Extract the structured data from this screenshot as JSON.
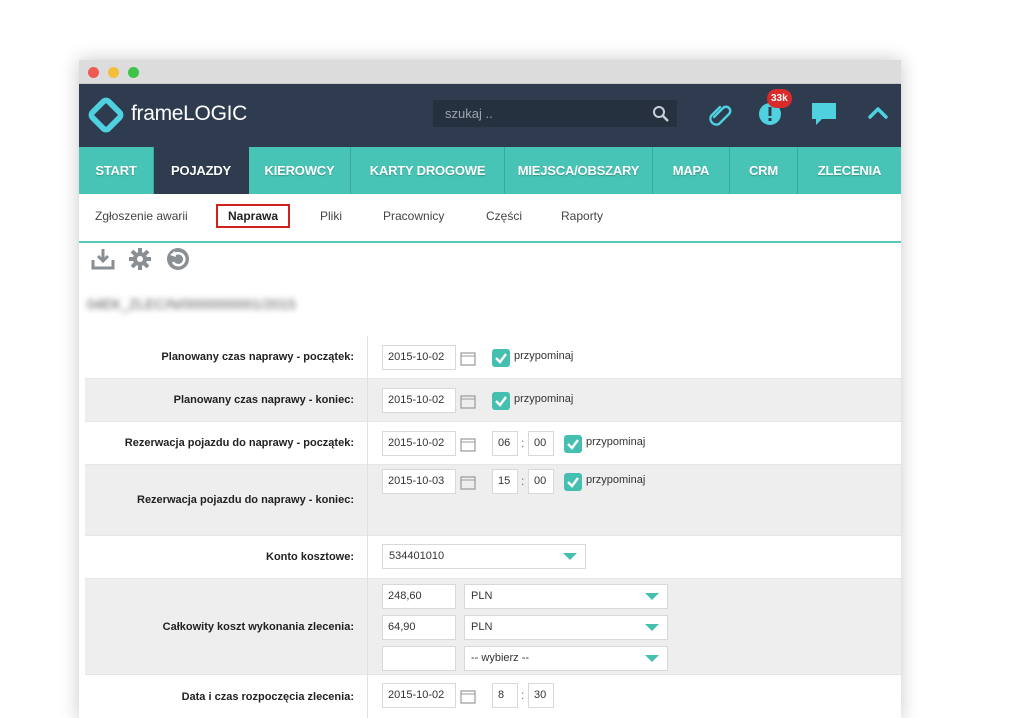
{
  "app": {
    "logo_text": "frameLOGIC"
  },
  "topbar": {
    "search_placeholder": "szukaj ..",
    "notifications_badge": "33k"
  },
  "nav": [
    {
      "label": "START",
      "active": false
    },
    {
      "label": "POJAZDY",
      "active": true
    },
    {
      "label": "KIEROWCY",
      "active": false
    },
    {
      "label": "KARTY DROGOWE",
      "active": false
    },
    {
      "label": "MIEJSCA/OBSZARY",
      "active": false
    },
    {
      "label": "MAPA",
      "active": false
    },
    {
      "label": "CRM",
      "active": false
    },
    {
      "label": "ZLECENIA",
      "active": false
    }
  ],
  "subnav": [
    {
      "label": "Zgłoszenie awarii",
      "active": false
    },
    {
      "label": "Naprawa",
      "active": true
    },
    {
      "label": "Pliki",
      "active": false
    },
    {
      "label": "Pracownicy",
      "active": false
    },
    {
      "label": "Części",
      "active": false
    },
    {
      "label": "Raporty",
      "active": false
    }
  ],
  "record_id": "04EK_ZLEC/N/0000000001/2015",
  "form": {
    "planned_start": {
      "label": "Planowany czas naprawy - początek:",
      "date": "2015-10-02",
      "remind": "przypominaj"
    },
    "planned_end": {
      "label": "Planowany czas naprawy - koniec:",
      "date": "2015-10-02",
      "remind": "przypominaj"
    },
    "reservation_start": {
      "label": "Rezerwacja pojazdu do naprawy - początek:",
      "date": "2015-10-02",
      "hour": "06",
      "minute": "00",
      "remind": "przypominaj"
    },
    "reservation_end": {
      "label": "Rezerwacja pojazdu do naprawy - koniec:",
      "date": "2015-10-03",
      "hour": "15",
      "minute": "00",
      "remind": "przypominaj"
    },
    "cost_account": {
      "label": "Konto kosztowe:",
      "value": "534401010"
    },
    "total_cost": {
      "label": "Całkowity koszt wykonania zlecenia:",
      "lines": [
        {
          "amount": "248,60",
          "currency": "PLN"
        },
        {
          "amount": "64,90",
          "currency": "PLN"
        },
        {
          "amount": "",
          "currency": "-- wybierz --"
        }
      ]
    },
    "order_start": {
      "label": "Data i czas rozpoczęcia zlecenia:",
      "date": "2015-10-02",
      "hour": "8",
      "minute": "30"
    }
  },
  "colors": {
    "teal": "#47c4b5",
    "navy": "#2f3c4f",
    "active_outline": "#d0211c"
  }
}
